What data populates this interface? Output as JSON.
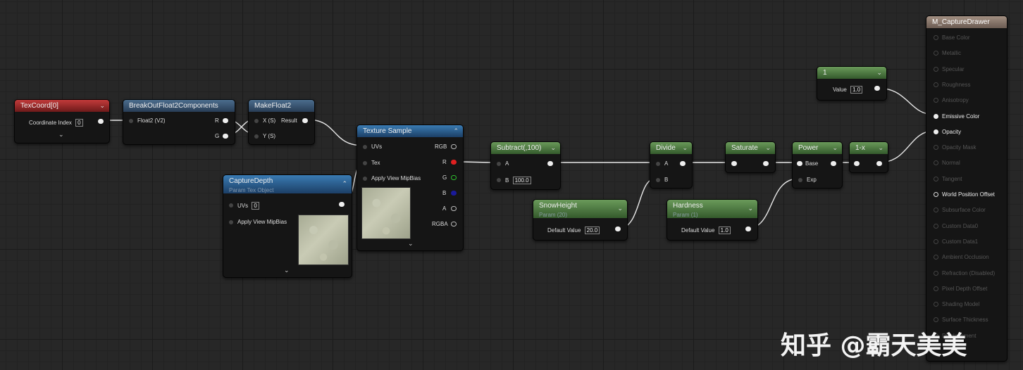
{
  "nodes": {
    "texcoord": {
      "title": "TexCoord[0]",
      "coord_label": "Coordinate Index",
      "coord_value": "0"
    },
    "breakout": {
      "title": "BreakOutFloat2Components",
      "in_label": "Float2 (V2)",
      "out_r": "R",
      "out_g": "G"
    },
    "makefloat2": {
      "title": "MakeFloat2",
      "in_x": "X (S)",
      "in_y": "Y (S)",
      "out": "Result"
    },
    "capturedepth": {
      "title": "CaptureDepth",
      "subtitle": "Param Tex Object",
      "uvs_label": "UVs",
      "uvs_value": "0",
      "mip_label": "Apply View MipBias"
    },
    "texsample": {
      "title": "Texture Sample",
      "in_uvs": "UVs",
      "in_tex": "Tex",
      "in_mip": "Apply View MipBias",
      "out_rgb": "RGB",
      "out_r": "R",
      "out_g": "G",
      "out_b": "B",
      "out_a": "A",
      "out_rgba": "RGBA"
    },
    "subtract": {
      "title": "Subtract(,100)",
      "in_a": "A",
      "in_b": "B",
      "b_value": "100.0"
    },
    "snowheight": {
      "title": "SnowHeight",
      "subtitle": "Param (20)",
      "label": "Default Value",
      "value": "20.0"
    },
    "divide": {
      "title": "Divide",
      "in_a": "A",
      "in_b": "B"
    },
    "saturate": {
      "title": "Saturate"
    },
    "power": {
      "title": "Power",
      "in_base": "Base",
      "in_exp": "Exp"
    },
    "oneminus": {
      "title": "1-x"
    },
    "hardness": {
      "title": "Hardness",
      "subtitle": "Param (1)",
      "label": "Default Value",
      "value": "1.0"
    },
    "constant": {
      "title": "1",
      "label": "Value",
      "value": "1.0"
    },
    "material": {
      "title": "M_CaptureDrawer",
      "inputs": [
        "Base Color",
        "Metallic",
        "Specular",
        "Roughness",
        "Anisotropy",
        "Emissive Color",
        "Opacity",
        "Opacity Mask",
        "Normal",
        "Tangent",
        "World Position Offset",
        "Subsurface Color",
        "Custom Data0",
        "Custom Data1",
        "Ambient Occlusion",
        "Refraction (Disabled)",
        "Pixel Depth Offset",
        "Shading Model",
        "Surface Thickness",
        "Displacement"
      ]
    }
  },
  "icons": {
    "collapse": "chevron-down-icon",
    "expand": "chevron-up-icon"
  },
  "watermark": "知乎 @霸天美美",
  "colors": {
    "param_red": "#c23a3a",
    "function_blue": "#4b6d8e",
    "param_green": "#6a9a5a",
    "material_header": "#a39082"
  }
}
